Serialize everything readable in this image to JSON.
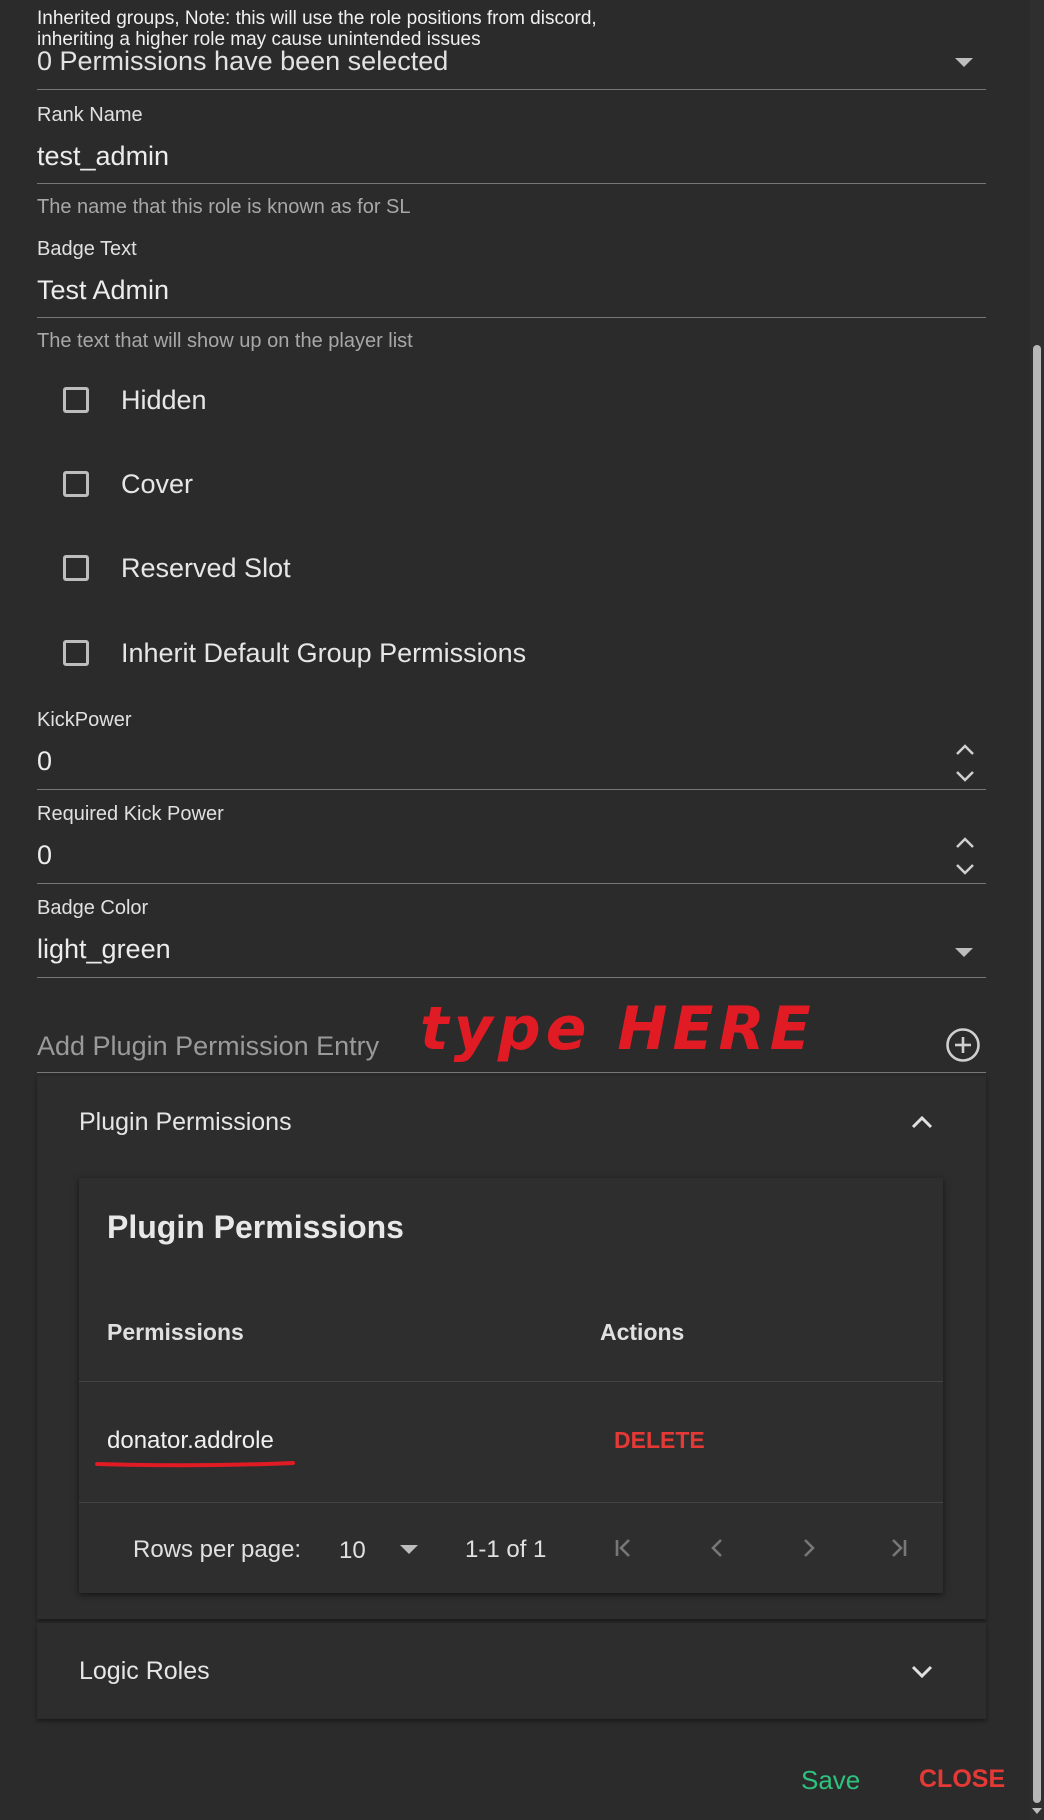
{
  "inherited": {
    "note_line1": "Inherited groups, Note: this will use the role positions from discord,",
    "note_line2": "inheriting a higher role may cause unintended issues",
    "value": "0 Permissions have been selected"
  },
  "rank_name": {
    "label": "Rank Name",
    "value": "test_admin",
    "hint": "The name that this role is known as for SL"
  },
  "badge_text": {
    "label": "Badge Text",
    "value": "Test Admin",
    "hint": "The text that will show up on the player list"
  },
  "checkboxes": {
    "hidden": "Hidden",
    "cover": "Cover",
    "reserved_slot": "Reserved Slot",
    "inherit_default": "Inherit Default Group Permissions"
  },
  "kick_power": {
    "label": "KickPower",
    "value": "0"
  },
  "required_kick_power": {
    "label": "Required Kick Power",
    "value": "0"
  },
  "badge_color": {
    "label": "Badge Color",
    "value": "light_green"
  },
  "plugin_entry": {
    "placeholder": "Add Plugin Permission Entry",
    "annotation": "type HERE"
  },
  "plugin_panel": {
    "header": "Plugin Permissions",
    "table_title": "Plugin Permissions",
    "columns": [
      "Permissions",
      "Actions"
    ],
    "rows": [
      {
        "permission": "donator.addrole",
        "action": "DELETE"
      }
    ],
    "footer": {
      "rows_per_page_label": "Rows per page:",
      "rows_per_page_value": "10",
      "range": "1-1 of 1"
    }
  },
  "logic_roles": {
    "header": "Logic Roles"
  },
  "actions": {
    "save": "Save",
    "close": "CLOSE"
  },
  "colors": {
    "background": "#2b2b2b",
    "delete": "#e53935",
    "save": "#2ec27e",
    "close": "#e53935",
    "annotation": "#e01b24"
  }
}
